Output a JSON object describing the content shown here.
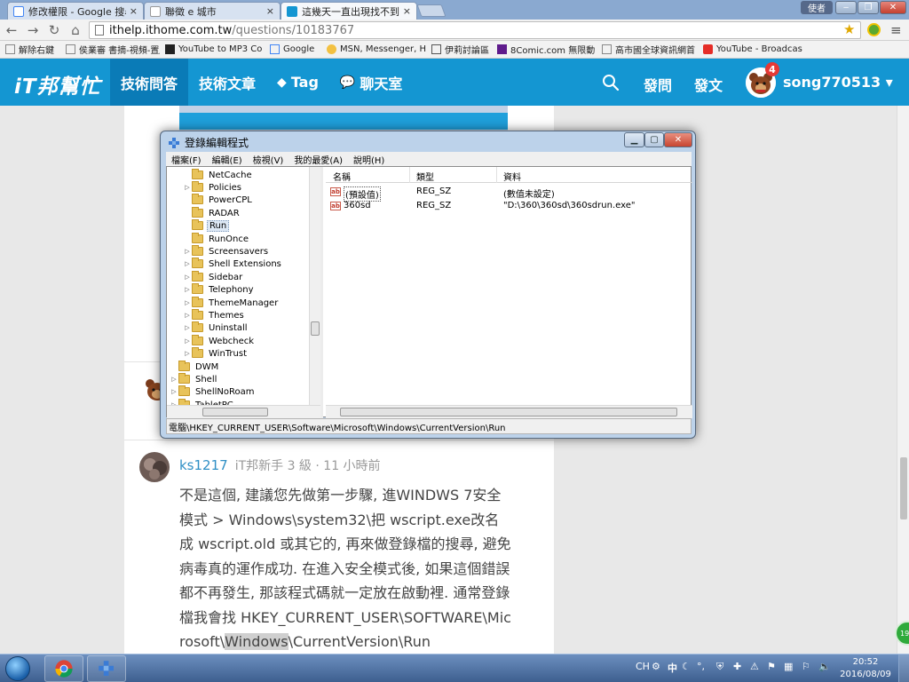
{
  "browser": {
    "tabs": [
      {
        "title": "修改權限 - Google 搜尋",
        "favicon": "google-icon",
        "active": false
      },
      {
        "title": "聯徵 e 城市",
        "favicon": "page-icon",
        "active": false
      },
      {
        "title": "這幾天一直出現找不到sc",
        "favicon": "ithome-icon",
        "active": true
      }
    ],
    "user_button": "使者",
    "url_host": "ithelp.ithome.com.tw",
    "url_path": "/questions/10183767",
    "bookmarks": [
      {
        "label": "解除右鍵",
        "icon": "page-icon"
      },
      {
        "label": "侯業審 書摘-視頻-置/",
        "icon": "page-icon"
      },
      {
        "label": "YouTube to MP3 Co",
        "icon": "youtube-icon"
      },
      {
        "label": "Google",
        "icon": "google-icon"
      },
      {
        "label": "MSN, Messenger, Ho",
        "icon": "msn-icon"
      },
      {
        "label": "伊莉討論區",
        "icon": "e-icon"
      },
      {
        "label": "8Comic.com 無限動",
        "icon": "yahoo-icon"
      },
      {
        "label": "高市國全球資訊網首",
        "icon": "page-icon"
      },
      {
        "label": "YouTube - Broadcas",
        "icon": "youtube-icon"
      }
    ]
  },
  "site": {
    "logo": "iT邦幫忙",
    "nav": [
      {
        "label": "技術問答",
        "active": true,
        "icon": ""
      },
      {
        "label": "技術文章",
        "active": false,
        "icon": ""
      },
      {
        "label": "Tag",
        "active": false,
        "icon": "tag-icon"
      },
      {
        "label": "聊天室",
        "active": false,
        "icon": "chat-icon"
      }
    ],
    "ask_label": "發問",
    "post_label": "發文",
    "notifications": "4",
    "username": "song770513",
    "accent": "#1496d2"
  },
  "regedit": {
    "title": "登錄編輯程式",
    "menu": [
      "檔案(F)",
      "編輯(E)",
      "檢視(V)",
      "我的最愛(A)",
      "說明(H)"
    ],
    "tree": [
      {
        "label": "NetCache",
        "expandable": false,
        "level": 2
      },
      {
        "label": "Policies",
        "expandable": true,
        "level": 2
      },
      {
        "label": "PowerCPL",
        "expandable": false,
        "level": 2
      },
      {
        "label": "RADAR",
        "expandable": false,
        "level": 2
      },
      {
        "label": "Run",
        "expandable": false,
        "level": 2,
        "selected": true
      },
      {
        "label": "RunOnce",
        "expandable": false,
        "level": 2
      },
      {
        "label": "Screensavers",
        "expandable": true,
        "level": 2
      },
      {
        "label": "Shell Extensions",
        "expandable": true,
        "level": 2
      },
      {
        "label": "Sidebar",
        "expandable": true,
        "level": 2
      },
      {
        "label": "Telephony",
        "expandable": true,
        "level": 2
      },
      {
        "label": "ThemeManager",
        "expandable": true,
        "level": 2
      },
      {
        "label": "Themes",
        "expandable": true,
        "level": 2
      },
      {
        "label": "Uninstall",
        "expandable": true,
        "level": 2
      },
      {
        "label": "Webcheck",
        "expandable": true,
        "level": 2
      },
      {
        "label": "WinTrust",
        "expandable": true,
        "level": 2
      },
      {
        "label": "DWM",
        "expandable": false,
        "level": 1
      },
      {
        "label": "Shell",
        "expandable": true,
        "level": 1
      },
      {
        "label": "ShellNoRoam",
        "expandable": true,
        "level": 1
      },
      {
        "label": "TabletPC",
        "expandable": true,
        "level": 1
      }
    ],
    "columns": [
      "名稱",
      "類型",
      "資料"
    ],
    "values": [
      {
        "name": "(預設值)",
        "type": "REG_SZ",
        "data": "(數值未設定)",
        "selected": true
      },
      {
        "name": "360sd",
        "type": "REG_SZ",
        "data": "\"D:\\360\\360sd\\360sdrun.exe\""
      }
    ],
    "status_path": "電腦\\HKEY_CURRENT_USER\\Software\\Microsoft\\Windows\\CurrentVersion\\Run"
  },
  "answer": {
    "author": "ks1217",
    "rank": "iT邦新手 3 級",
    "time": "11 小時前",
    "text_main": "不是這個, 建議您先做第一步驟, 進WINDWS 7安全模式 > Windows\\system32\\把 wscript.exe改名成 wscript.old 或其它的, 再來做登錄檔的搜尋, 避免病毒真的運作成功. 在進入安全模式後, 如果這個錯誤都不再發生, 那該程式碼就一定放在啟動裡. 通常登錄檔我會找 HKEY_CURRENT_USER\\SOFTWARE\\Microsoft\\",
    "text_highlight": "Windows",
    "text_end": "\\CurrentVersion\\Run"
  },
  "taskbar": {
    "ime_lang": "CH",
    "ime_mode": "中",
    "time": "20:52",
    "date": "2016/08/09"
  }
}
